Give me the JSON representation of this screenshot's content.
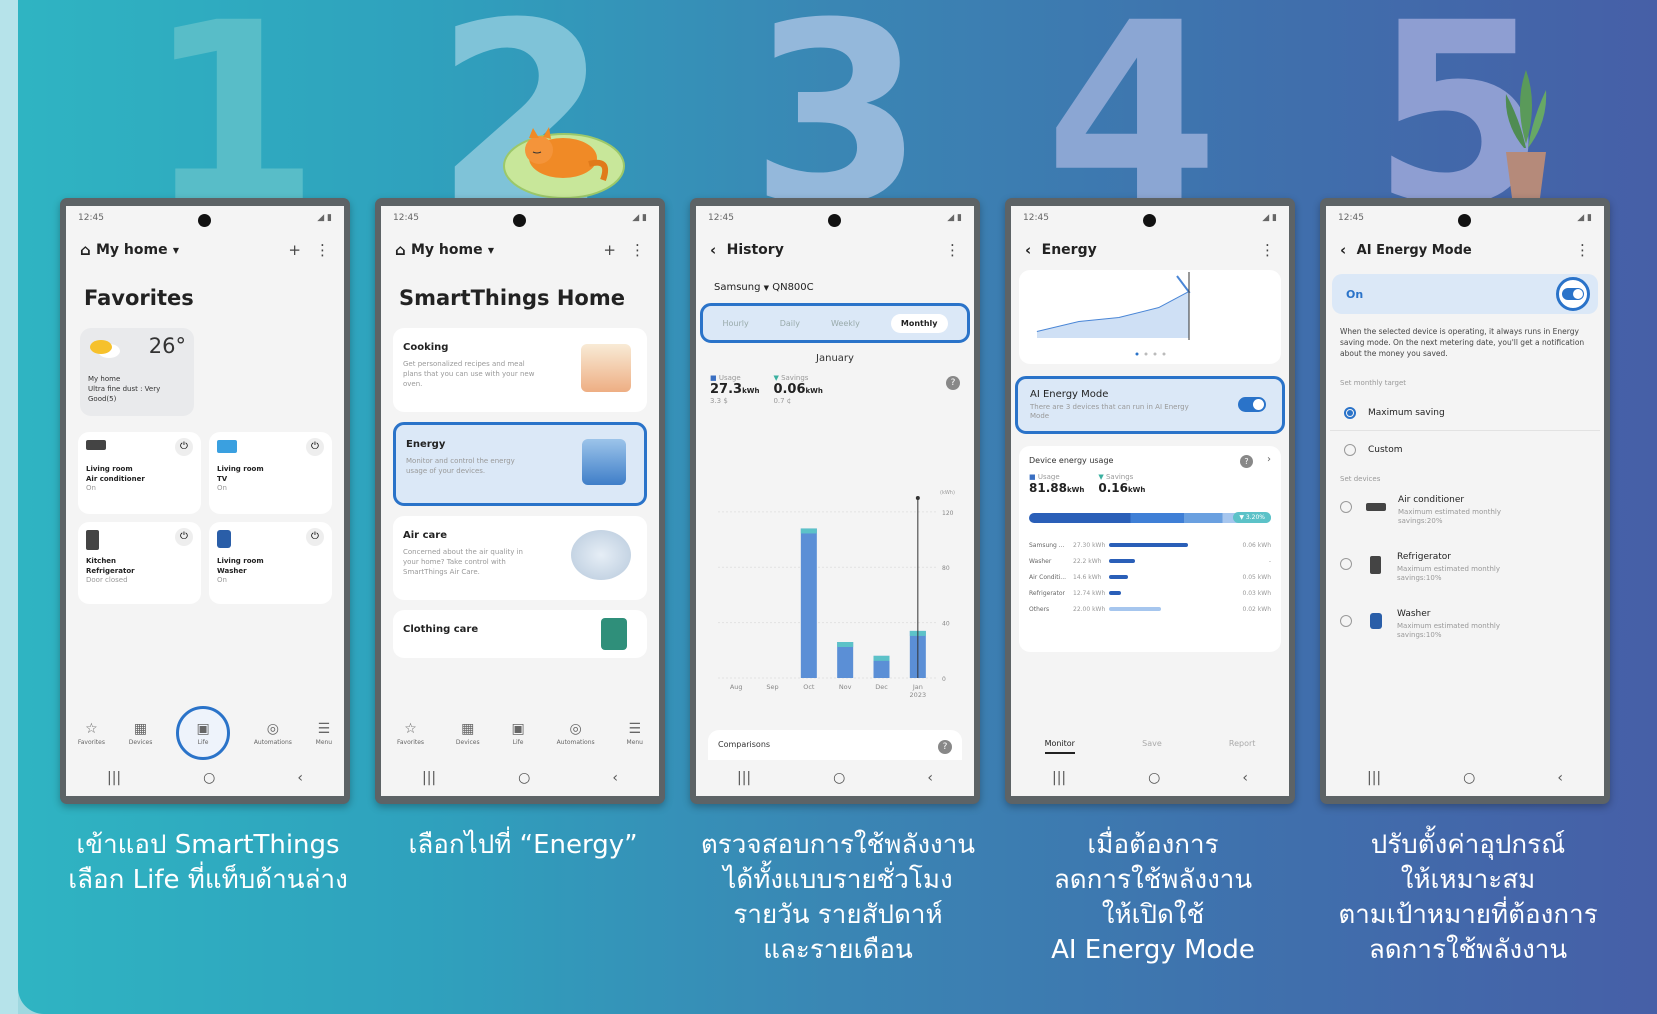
{
  "steps": [
    {
      "num": "1",
      "caption": [
        "เข้าแอป SmartThings",
        "เลือก Life ที่แท็บด้านล่าง"
      ]
    },
    {
      "num": "2",
      "caption": [
        "เลือกไปที่ “Energy”"
      ]
    },
    {
      "num": "3",
      "caption": [
        "ตรวจสอบการใช้พลังงาน",
        "ได้ทั้งแบบรายชั่วโมง",
        "รายวัน รายสัปดาห์",
        "และรายเดือน"
      ]
    },
    {
      "num": "4",
      "caption": [
        "เมื่อต้องการ",
        "ลดการใช้พลังงาน",
        "ให้เปิดใช้",
        "AI Energy Mode"
      ]
    },
    {
      "num": "5",
      "caption": [
        "ปรับตั้งค่าอุปกรณ์",
        "ให้เหมาะสม",
        "ตามเป้าหมายที่ต้องการ",
        "ลดการใช้พลังงาน"
      ]
    }
  ],
  "colors": {
    "accent": "#2a73c9",
    "bar": "#5b8fd6",
    "barTop": "#5cc2c8"
  },
  "status_time": "12:45",
  "screen1": {
    "header": "My home",
    "title": "Favorites",
    "weather": {
      "temp": "26°",
      "home": "My home",
      "dust": "Ultra fine dust : Very Good(5)"
    },
    "devices": [
      {
        "room": "Living room",
        "name": "Air conditioner",
        "state": "On",
        "icon": "air-conditioner-icon"
      },
      {
        "room": "Living room",
        "name": "TV",
        "state": "On",
        "icon": "tv-icon"
      },
      {
        "room": "Kitchen",
        "name": "Refrigerator",
        "state": "Door closed",
        "icon": "refrigerator-icon"
      },
      {
        "room": "Living room",
        "name": "Washer",
        "state": "On",
        "icon": "washer-icon"
      }
    ],
    "tabs": [
      "Favorites",
      "Devices",
      "Life",
      "Automations",
      "Menu"
    ]
  },
  "screen2": {
    "header": "My home",
    "title": "SmartThings Home",
    "cards": [
      {
        "title": "Cooking",
        "desc": "Get personalized recipes and meal plans that you can use with your new oven."
      },
      {
        "title": "Energy",
        "desc": "Monitor and control the energy usage of your devices."
      },
      {
        "title": "Air care",
        "desc": "Concerned about the air quality in your home? Take control with SmartThings Air Care."
      },
      {
        "title": "Clothing care",
        "desc": ""
      }
    ],
    "tabs": [
      "Favorites",
      "Devices",
      "Life",
      "Automations",
      "Menu"
    ]
  },
  "screen3": {
    "title": "History",
    "device_brand": "Samsung",
    "device_model": "QN800C",
    "tabs": [
      "Hourly",
      "Daily",
      "Weekly",
      "Monthly"
    ],
    "month": "January",
    "usage_label": "Usage",
    "usage": "27.3",
    "usage_unit": "kWh",
    "usage_cost": "3.3 $",
    "savings_label": "Savings",
    "savings": "0.06",
    "savings_unit": "kWh",
    "savings_cost": "0.7 ¢",
    "comparisons": "Comparisons",
    "chart_data": {
      "type": "bar",
      "categories": [
        "Aug",
        "Sep",
        "Oct",
        "Nov",
        "Dec",
        "Jan 2023"
      ],
      "values": [
        0,
        0,
        108,
        26,
        16,
        34
      ],
      "ylim": [
        0,
        130
      ],
      "yticks": [
        "120",
        "80",
        "40",
        "0"
      ],
      "ylabel": "(kWh)"
    }
  },
  "screen4": {
    "title": "Energy",
    "ai_title": "AI Energy Mode",
    "ai_desc": "There are 3 devices that can run in AI Energy Mode",
    "usage_title": "Device energy usage",
    "usage_label": "Usage",
    "usage": "81.88",
    "savings_label": "Savings",
    "savings": "0.16",
    "unit": "kWh",
    "badge": "▼ 3.20%",
    "rows": [
      {
        "name": "Samsung ...",
        "kwh": "27.30 kWh",
        "save": "0.06 kWh",
        "frac": 0.92
      },
      {
        "name": "Washer",
        "kwh": "22.2 kWh",
        "save": "-",
        "frac": 0.3
      },
      {
        "name": "Air Conditi...",
        "kwh": "14.6 kWh",
        "save": "0.05 kWh",
        "frac": 0.22
      },
      {
        "name": "Refrigerator",
        "kwh": "12.74 kWh",
        "save": "0.03 kWh",
        "frac": 0.14
      },
      {
        "name": "Others",
        "kwh": "22.00 kWh",
        "save": "0.02 kWh",
        "frac": 0.6
      }
    ],
    "bottom_tabs": [
      "Monitor",
      "Save",
      "Report"
    ]
  },
  "screen5": {
    "title": "AI Energy Mode",
    "on": "On",
    "desc": "When the selected device is operating, it always runs in Energy saving mode. On the next metering date, you'll get a notification about the money you saved.",
    "target_label": "Set monthly target",
    "options": [
      "Maximum saving",
      "Custom"
    ],
    "devices_label": "Set devices",
    "devices": [
      {
        "name": "Air conditioner",
        "desc": "Maximum estimated monthly savings:20%",
        "icon": "air-conditioner-icon"
      },
      {
        "name": "Refrigerator",
        "desc": "Maximum estimated monthly savings:10%",
        "icon": "refrigerator-icon"
      },
      {
        "name": "Washer",
        "desc": "Maximum estimated monthly savings:10%",
        "icon": "washer-icon"
      }
    ]
  }
}
